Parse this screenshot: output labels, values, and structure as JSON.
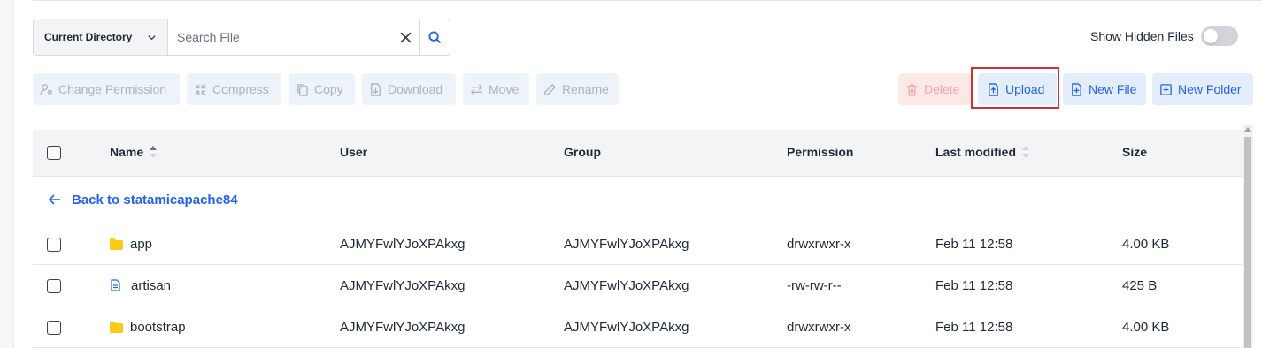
{
  "search": {
    "directory_label": "Current Directory",
    "placeholder": "Search File",
    "value": ""
  },
  "hidden_files": {
    "label": "Show Hidden Files",
    "enabled": false
  },
  "toolbar": {
    "change_permission": "Change Permission",
    "compress": "Compress",
    "copy": "Copy",
    "download": "Download",
    "move": "Move",
    "rename": "Rename",
    "delete": "Delete",
    "upload": "Upload",
    "new_file": "New File",
    "new_folder": "New Folder"
  },
  "table": {
    "columns": {
      "name": "Name",
      "user": "User",
      "group": "Group",
      "permission": "Permission",
      "last_modified": "Last modified",
      "size": "Size"
    },
    "back_link": "Back to statamicapache84",
    "rows": [
      {
        "type": "folder",
        "name": "app",
        "user": "AJMYFwlYJoXPAkxg",
        "group": "AJMYFwlYJoXPAkxg",
        "permission": "drwxrwxr-x",
        "modified": "Feb 11 12:58",
        "size": "4.00 KB"
      },
      {
        "type": "file",
        "name": "artisan",
        "user": "AJMYFwlYJoXPAkxg",
        "group": "AJMYFwlYJoXPAkxg",
        "permission": "-rw-rw-r--",
        "modified": "Feb 11 12:58",
        "size": "425 B"
      },
      {
        "type": "folder",
        "name": "bootstrap",
        "user": "AJMYFwlYJoXPAkxg",
        "group": "AJMYFwlYJoXPAkxg",
        "permission": "drwxrwxr-x",
        "modified": "Feb 11 12:58",
        "size": "4.00 KB"
      }
    ]
  },
  "colors": {
    "accent": "#2563eb",
    "folder": "#facc15",
    "danger": "#f3a7a7",
    "highlight_box": "#d32f2f"
  }
}
